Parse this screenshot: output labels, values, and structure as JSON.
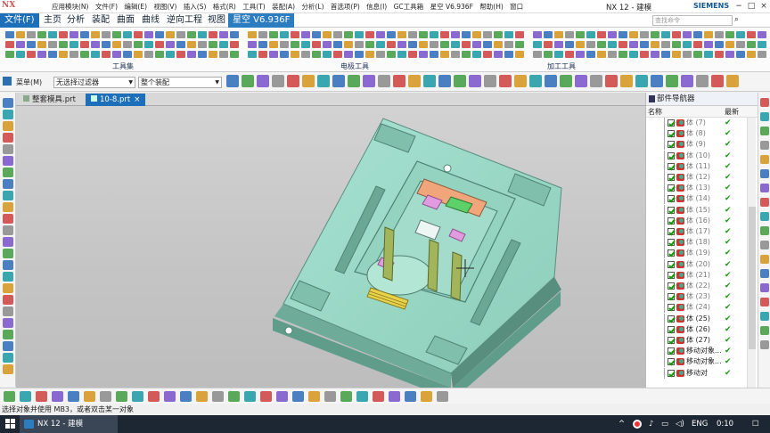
{
  "titlebar": {
    "logo": "NX",
    "menu": [
      "应用模块(N)",
      "文件(F)",
      "编辑(E)",
      "视图(V)",
      "插入(S)",
      "格式(R)",
      "工具(T)",
      "装配(A)",
      "分析(L)",
      "首选项(P)",
      "信息(I)",
      "GC工具箱",
      "星空 V6.936F",
      "帮助(H)",
      "窗口"
    ],
    "app_title": "NX 12 - 建模",
    "brand": "SIEMENS"
  },
  "ribbon_tabs": [
    "文件(F)",
    "主页",
    "分析",
    "装配",
    "曲面",
    "曲线",
    "逆向工程",
    "视图",
    "星空 V6.936F"
  ],
  "search_placeholder": "查找命令",
  "ribbon_groups": [
    "工具集",
    "电极工具",
    "加工工具"
  ],
  "toolbar2": {
    "menu_label": "菜单(M)",
    "filter": "无选择过滤器",
    "scope": "整个装配"
  },
  "doc_tabs": [
    "整套模具.prt",
    "10-8.prt"
  ],
  "navigator": {
    "title": "部件导航器",
    "col_name": "名称",
    "col_latest": "最新",
    "rows": [
      {
        "label": "体 (7)",
        "dim": true
      },
      {
        "label": "体 (8)",
        "dim": true
      },
      {
        "label": "体 (9)",
        "dim": true
      },
      {
        "label": "体 (10)",
        "dim": true
      },
      {
        "label": "体 (11)",
        "dim": true
      },
      {
        "label": "体 (12)",
        "dim": true
      },
      {
        "label": "体 (13)",
        "dim": true
      },
      {
        "label": "体 (14)",
        "dim": true
      },
      {
        "label": "体 (15)",
        "dim": true
      },
      {
        "label": "体 (16)",
        "dim": true
      },
      {
        "label": "体 (17)",
        "dim": true
      },
      {
        "label": "体 (18)",
        "dim": true
      },
      {
        "label": "体 (19)",
        "dim": true
      },
      {
        "label": "体 (20)",
        "dim": true
      },
      {
        "label": "体 (21)",
        "dim": true
      },
      {
        "label": "体 (22)",
        "dim": true
      },
      {
        "label": "体 (23)",
        "dim": true
      },
      {
        "label": "体 (24)",
        "dim": true
      },
      {
        "label": "体 (25)",
        "dim": false
      },
      {
        "label": "体 (26)",
        "dim": false
      },
      {
        "label": "体 (27)",
        "dim": false
      },
      {
        "label": "移动对象...",
        "dim": false
      },
      {
        "label": "移动对象...",
        "dim": false
      },
      {
        "label": "移动对",
        "dim": false
      }
    ]
  },
  "status_text": "选择对象并使用 MB3，或者双击某一对象",
  "taskbar": {
    "app": "NX 12 - 建模",
    "ime": "ENG",
    "time": "0:10"
  },
  "colors": {
    "accent": "#1c6fb8",
    "mold": "#9ed8c8",
    "check": "#1a9a1a"
  }
}
